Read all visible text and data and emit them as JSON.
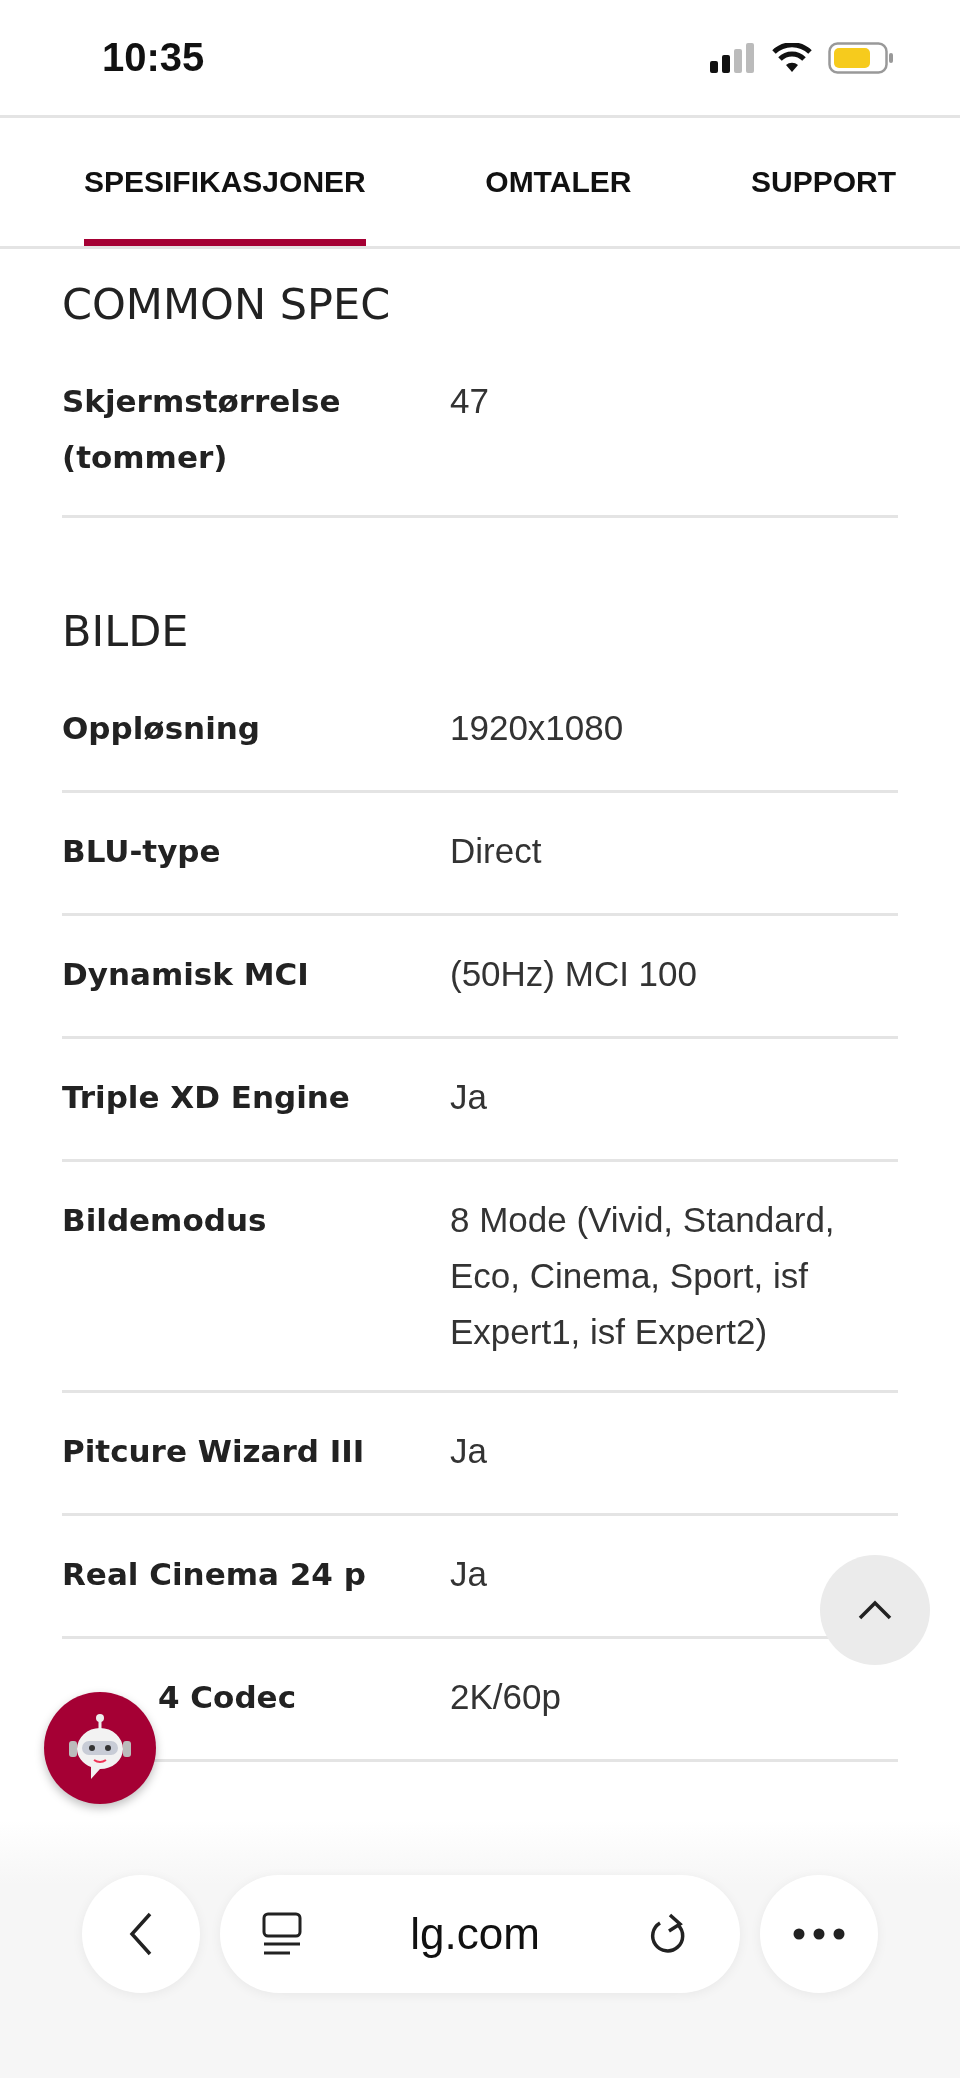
{
  "status_bar": {
    "time": "10:35"
  },
  "tabs": [
    {
      "label": "SPESIFIKASJONER",
      "selected": true
    },
    {
      "label": "OMTALER",
      "selected": false
    },
    {
      "label": "SUPPORT",
      "selected": false
    }
  ],
  "sections": [
    {
      "title": "COMMON SPEC",
      "rows": [
        {
          "label": "Skjermstørrelse (tommer)",
          "value": "47"
        }
      ]
    },
    {
      "title": "BILDE",
      "rows": [
        {
          "label": "Oppløsning",
          "value": "1920x1080"
        },
        {
          "label": "BLU-type",
          "value": "Direct"
        },
        {
          "label": "Dynamisk MCI",
          "value": "(50Hz) MCI 100"
        },
        {
          "label": "Triple XD Engine",
          "value": "Ja"
        },
        {
          "label": "Bildemodus",
          "value": "8 Mode (Vivid, Standard, Eco, Cinema, Sport, isf Expert1, isf Expert2)"
        },
        {
          "label": "Pitcure Wizard III",
          "value": "Ja"
        },
        {
          "label": "Real Cinema 24 p",
          "value": "Ja"
        },
        {
          "label": "4 Codec",
          "value": "2K/60p",
          "kind": "obscured"
        }
      ]
    }
  ],
  "browser_bar": {
    "address": "lg.com"
  }
}
